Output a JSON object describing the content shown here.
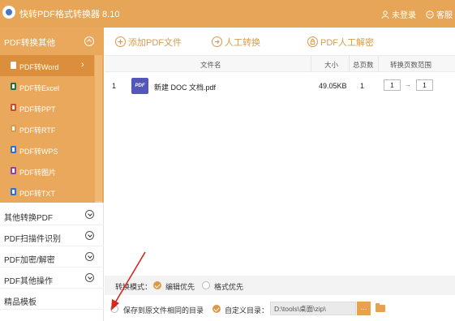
{
  "app": {
    "title": "快转PDF格式转换器 8.10",
    "login": "未登录",
    "service": "客服"
  },
  "sidebar": {
    "active_group": "PDF转换其他",
    "sub_items": [
      {
        "label": "PDF转Word",
        "icon": "word-doc-icon",
        "color": "#2b5797"
      },
      {
        "label": "PDF转Excel",
        "icon": "excel-doc-icon",
        "color": "#1e7145"
      },
      {
        "label": "PDF转PPT",
        "icon": "ppt-doc-icon",
        "color": "#d24726"
      },
      {
        "label": "PDF转RTF",
        "icon": "rtf-doc-icon",
        "color": "#d99a49"
      },
      {
        "label": "PDF转WPS",
        "icon": "wps-doc-icon",
        "color": "#2b72c9"
      },
      {
        "label": "PDF转图片",
        "icon": "image-doc-icon",
        "color": "#8e44ad"
      },
      {
        "label": "PDF转TXT",
        "icon": "txt-doc-icon",
        "color": "#2b72c9"
      }
    ],
    "categories": [
      "其他转换PDF",
      "PDF扫描件识别",
      "PDF加密/解密",
      "PDF其他操作",
      "精品模板"
    ]
  },
  "toolbar": {
    "add_pdf": "添加PDF文件",
    "manual": "人工转换",
    "pdf_decrypt": "PDF人工解密"
  },
  "table": {
    "headers": {
      "filename": "文件名",
      "size": "大小",
      "pages": "总页数",
      "range": "转换页数范围"
    },
    "rows": [
      {
        "index": "1",
        "icon_text": "PDF",
        "filename": "新建 DOC 文档.pdf",
        "size": "49.05KB",
        "pages": "1",
        "range_from": "1",
        "range_to": "1"
      }
    ]
  },
  "mode": {
    "label": "转换模式：",
    "option1": "编辑优先",
    "option2": "格式优先",
    "selected": "编辑优先"
  },
  "output": {
    "same_dir": "保存到原文件相同的目录",
    "custom_dir": "自定义目录：",
    "path": "D:\\tools\\桌面\\zip\\",
    "browse": "..."
  },
  "colors": {
    "accent": "#e7a657",
    "accent_dark": "#db8f3c",
    "annotation": "#d9261c"
  }
}
